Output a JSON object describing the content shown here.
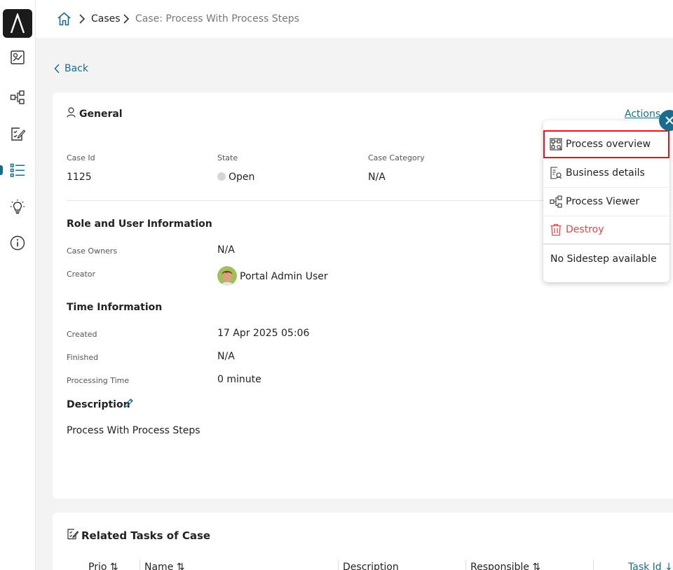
{
  "breadcrumb": {
    "items": [
      "Cases",
      "Case: Process With Process Steps"
    ]
  },
  "back_label": "Back",
  "general": {
    "title": "General",
    "case_id_label": "Case Id",
    "case_id_value": "1125",
    "state_label": "State",
    "state_value": "Open",
    "category_label": "Case Category",
    "category_value": "N/A"
  },
  "role": {
    "title": "Role and User Information",
    "owners_label": "Case Owners",
    "owners_value": "N/A",
    "creator_label": "Creator",
    "creator_value": "Portal Admin User"
  },
  "time": {
    "title": "Time Information",
    "created_label": "Created",
    "created_value": "17 Apr 2025 05:06",
    "finished_label": "Finished",
    "finished_value": "N/A",
    "processing_label": "Processing Time",
    "processing_value": "0 minute"
  },
  "description": {
    "title": "Description",
    "value": "Process With Process Steps"
  },
  "actions": {
    "label": "Actions",
    "menu": {
      "items": [
        "Process overview",
        "Business details",
        "Process Viewer",
        "Destroy"
      ],
      "note": "No Sidestep available"
    }
  },
  "related": {
    "title": "Related Tasks of Case",
    "columns": [
      "Prio",
      "Name",
      "Description",
      "Responsible",
      "Task Id"
    ]
  },
  "colors": {
    "accent": "#1a6c8c",
    "danger": "#e0474c",
    "highlight": "#e0191e"
  }
}
